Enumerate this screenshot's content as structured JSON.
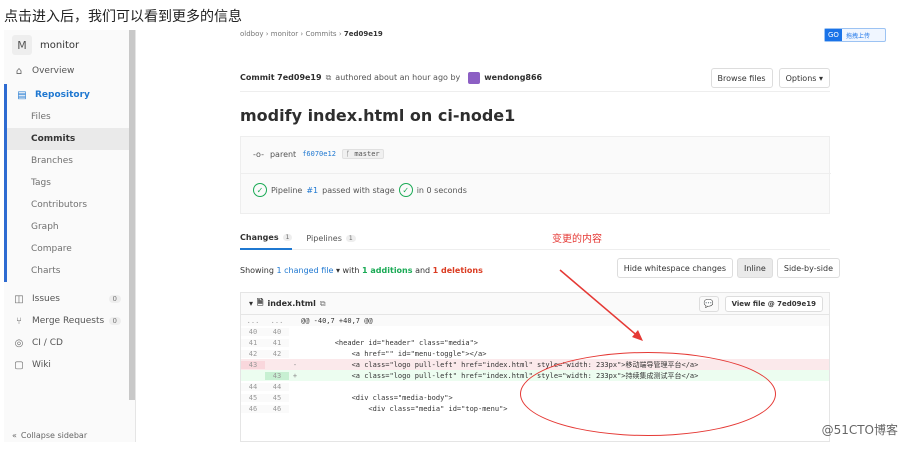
{
  "article": {
    "intro": "点击进入后，我们可以看到更多的信息"
  },
  "sidebar": {
    "project_letter": "M",
    "project_name": "monitor",
    "overview": "Overview",
    "repository": "Repository",
    "repo_items": [
      "Files",
      "Commits",
      "Branches",
      "Tags",
      "Contributors",
      "Graph",
      "Compare",
      "Charts"
    ],
    "issues": "Issues",
    "issues_count": "0",
    "merge_requests": "Merge Requests",
    "mr_count": "0",
    "cicd": "CI / CD",
    "wiki": "Wiki",
    "collapse": "Collapse sidebar"
  },
  "breadcrumb": {
    "items": [
      "oldboy",
      "monitor",
      "Commits"
    ],
    "current": "7ed09e19"
  },
  "upload": {
    "badge": "GO",
    "label": "拖拽上传"
  },
  "commit": {
    "label": "Commit",
    "sha": "7ed09e19",
    "authored": "authored about an hour ago by",
    "author": "wendong866",
    "browse_files": "Browse files",
    "options": "Options"
  },
  "title": "modify index.html on ci-node1",
  "parent": {
    "label": "parent",
    "sha": "f6070e12",
    "branch": "master"
  },
  "pipeline": {
    "pre": "Pipeline",
    "id": "#1",
    "mid": "passed with stage",
    "post": "in 0 seconds"
  },
  "tabs": {
    "changes": "Changes",
    "changes_count": "1",
    "pipelines": "Pipelines",
    "pipelines_count": "1"
  },
  "annotation": "变更的内容",
  "stats": {
    "showing": "Showing",
    "changed": "1 changed file",
    "with": "with",
    "add": "1 additions",
    "and": "and",
    "del": "1 deletions"
  },
  "view": {
    "hide_ws": "Hide whitespace changes",
    "inline": "Inline",
    "side": "Side-by-side"
  },
  "file": {
    "name": "index.html",
    "view_file": "View file @ 7ed09e19"
  },
  "diff": {
    "hunk": "@@ -40,7 +40,7 @@",
    "lines": [
      {
        "type": "ctx",
        "old": "40",
        "new": "40",
        "text": ""
      },
      {
        "type": "ctx",
        "old": "41",
        "new": "41",
        "text": "        <header id=\"header\" class=\"media\">"
      },
      {
        "type": "ctx",
        "old": "42",
        "new": "42",
        "text": "            <a href=\"\" id=\"menu-toggle\"></a>"
      },
      {
        "type": "del",
        "old": "43",
        "new": "",
        "text": "            <a class=\"logo pull-left\" href=\"index.html\" style=\"width: 233px\">移动端导管理平台</a>"
      },
      {
        "type": "add",
        "old": "",
        "new": "43",
        "text": "            <a class=\"logo pull-left\" href=\"index.html\" style=\"width: 233px\">持续集成测试平台</a>"
      },
      {
        "type": "ctx",
        "old": "44",
        "new": "44",
        "text": ""
      },
      {
        "type": "ctx",
        "old": "45",
        "new": "45",
        "text": "            <div class=\"media-body\">"
      },
      {
        "type": "ctx",
        "old": "46",
        "new": "46",
        "text": "                <div class=\"media\" id=\"top-menu\">"
      }
    ]
  },
  "watermark": "@51CTO博客"
}
